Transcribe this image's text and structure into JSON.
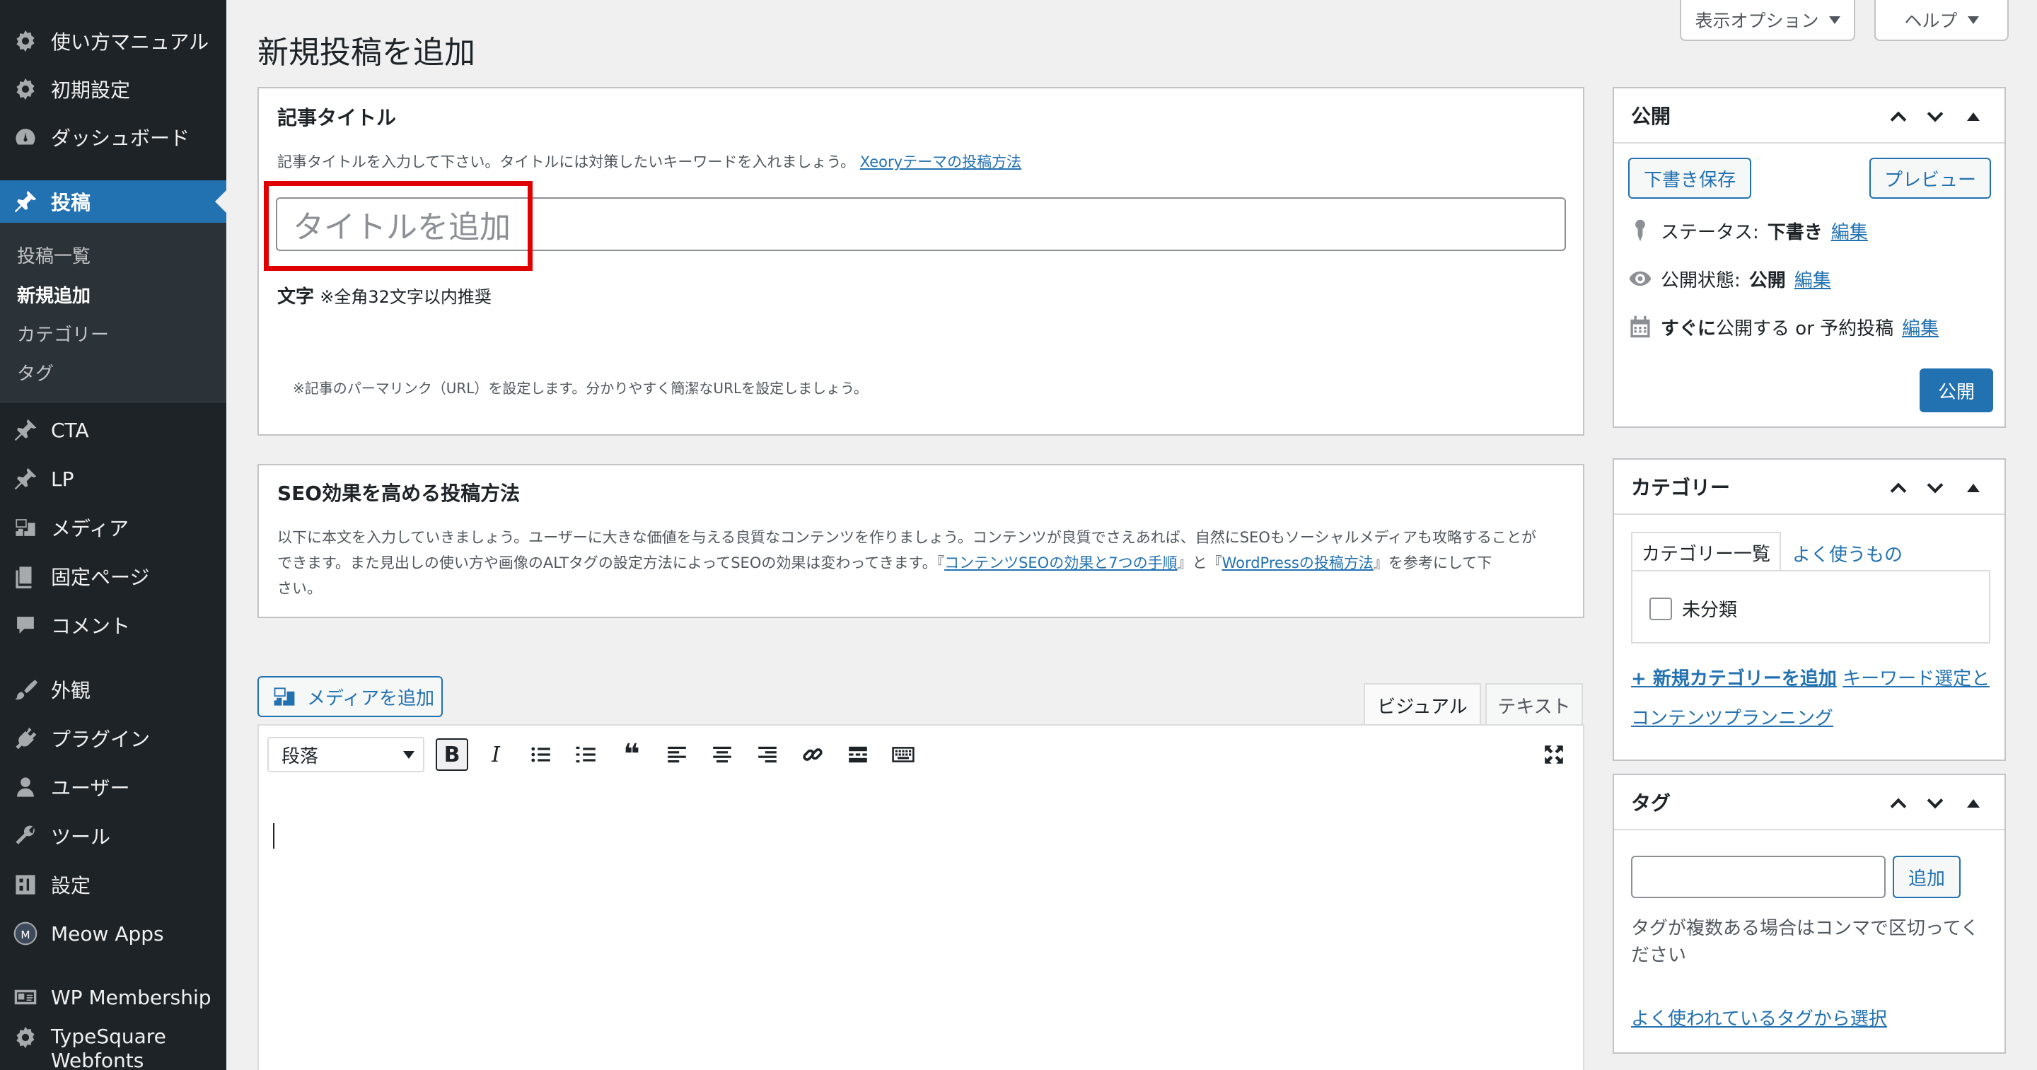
{
  "sidebar": {
    "items": [
      {
        "label": "使い方マニュアル",
        "icon": "gear-icon"
      },
      {
        "label": "初期設定",
        "icon": "gear-icon"
      },
      {
        "label": "ダッシュボード",
        "icon": "dashboard-icon"
      },
      {
        "label": "投稿",
        "icon": "pin-icon"
      },
      {
        "label": "CTA",
        "icon": "pin-icon"
      },
      {
        "label": "LP",
        "icon": "pin-icon"
      },
      {
        "label": "メディア",
        "icon": "media-icon"
      },
      {
        "label": "固定ページ",
        "icon": "page-icon"
      },
      {
        "label": "コメント",
        "icon": "comment-icon"
      },
      {
        "label": "外観",
        "icon": "brush-icon"
      },
      {
        "label": "プラグイン",
        "icon": "plugin-icon"
      },
      {
        "label": "ユーザー",
        "icon": "user-icon"
      },
      {
        "label": "ツール",
        "icon": "wrench-icon"
      },
      {
        "label": "設定",
        "icon": "settings-icon"
      },
      {
        "label": "Meow Apps",
        "icon": "meow-apps-icon"
      },
      {
        "label": "WP Membership",
        "icon": "membership-icon"
      },
      {
        "label": "TypeSquare Webfonts",
        "icon": "gear-icon"
      }
    ],
    "submenu": [
      "投稿一覧",
      "新規追加",
      "カテゴリー",
      "タグ"
    ]
  },
  "screen_options": {
    "display_label": "表示オプション",
    "help_label": "ヘルプ"
  },
  "page_title": "新規投稿を追加",
  "title_panel": {
    "heading": "記事タイトル",
    "description": "記事タイトルを入力して下さい。タイトルには対策したいキーワードを入れましょう。",
    "link_text": "Xeoryテーマの投稿方法",
    "placeholder": "タイトルを追加",
    "char_label": "文字",
    "char_note": "※全角32文字以内推奨",
    "permalink_note": "※記事のパーマリンク（URL）を設定します。分かりやすく簡潔なURLを設定しましょう。"
  },
  "seo_panel": {
    "heading": "SEO効果を高める投稿方法",
    "line1": "以下に本文を入力していきましょう。ユーザーに大きな価値を与える良質なコンテンツを作りましょう。コンテンツが良質でさえあれば、自然にSEOもソーシャルメディアも攻略することが",
    "line2_a": "できます。また見出しの使い方や画像のALTタグの設定方法によってSEOの効果は変わってきます。『",
    "link1": "コンテンツSEOの効果と7つの手順",
    "line2_b": "』と『",
    "link2": "WordPressの投稿方法",
    "line2_c": "』を参考にして下",
    "line3": "さい。"
  },
  "editor": {
    "media_button": "メディアを追加",
    "tab_visual": "ビジュアル",
    "tab_text": "テキスト",
    "format_select": "段落"
  },
  "publish_box": {
    "title": "公開",
    "save_draft": "下書き保存",
    "preview": "プレビュー",
    "status_label": "ステータス:",
    "status_value": "下書き",
    "visibility_label": "公開状態:",
    "visibility_value": "公開",
    "schedule_bold": "すぐに",
    "schedule_text": "公開する or 予約投稿",
    "edit": "編集",
    "publish": "公開"
  },
  "category_box": {
    "title": "カテゴリー",
    "tab_all": "カテゴリー一覧",
    "tab_popular": "よく使うもの",
    "item": "未分類",
    "add_new": "+ 新規カテゴリーを追加",
    "link_line1": "キーワード選定と",
    "link_line2": "コンテンツプランニング"
  },
  "tag_box": {
    "title": "タグ",
    "add": "追加",
    "help1": "タグが複数ある場合はコンマで区切ってく",
    "help2": "ださい",
    "choose": "よく使われているタグから選択"
  },
  "colors": {
    "accent": "#2271b1",
    "sidebar": "#1d2327",
    "highlight": "#e00000"
  }
}
